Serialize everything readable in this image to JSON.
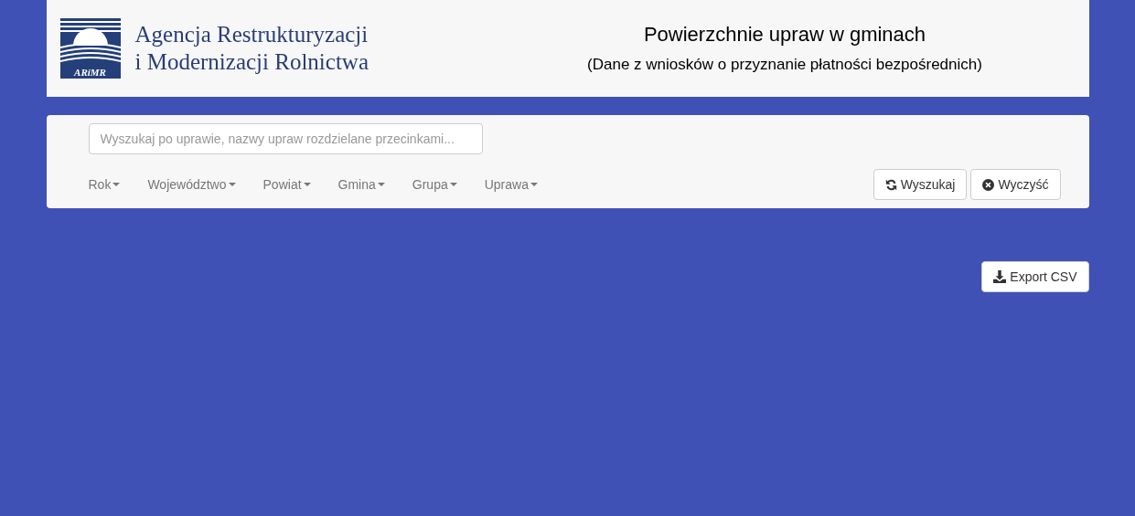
{
  "header": {
    "logo_mark": "ARiMR",
    "logo_lines": [
      "Agencja Restrukturyzacji",
      "i Modernizacji Rolnictwa"
    ],
    "title": "Powierzchnie upraw w gminach",
    "subtitle": "(Dane z wniosków o przyznanie płatności bezpośrednich)"
  },
  "filters": {
    "search": {
      "placeholder": "Wyszukaj po uprawie, nazwy upraw rozdzielane przecinkami..."
    },
    "dropdowns": [
      "Rok",
      "Województwo",
      "Powiat",
      "Gmina",
      "Grupa",
      "Uprawa"
    ],
    "buttons": [
      {
        "kind": "refresh",
        "label": "Wyszukaj"
      },
      {
        "kind": "clear",
        "label": "Wyczyść"
      }
    ]
  },
  "export_button": {
    "kind": "download",
    "label": "Export CSV"
  }
}
